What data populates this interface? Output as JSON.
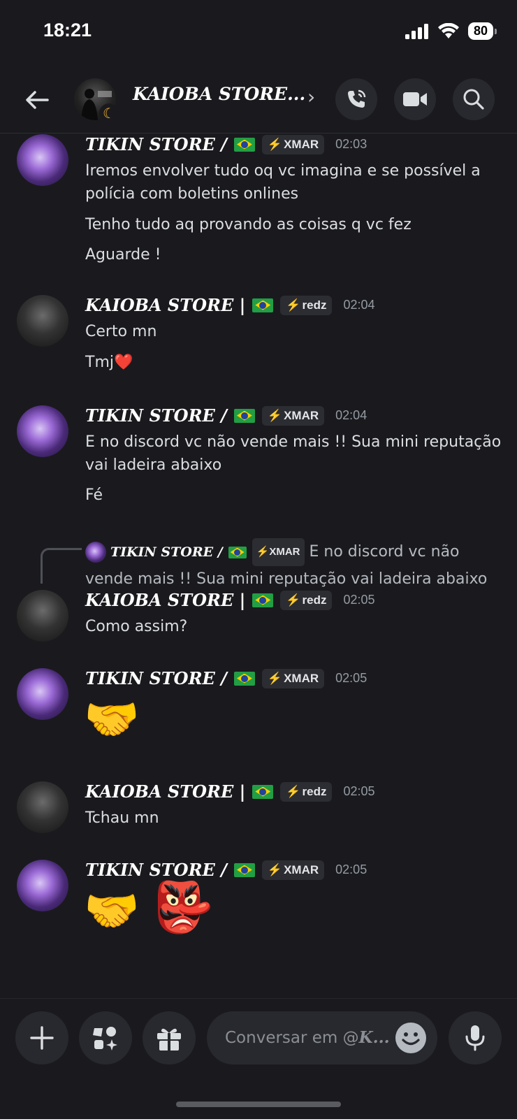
{
  "status_bar": {
    "time": "18:21",
    "battery": "80"
  },
  "header": {
    "title": "KAIOBA STORE..."
  },
  "messages": [
    {
      "author": "TIKIN STORE /",
      "tag": "XMAR",
      "time": "02:03",
      "lines": [
        "Iremos envolver tudo oq vc imagina e se possível a",
        "polícia com boletins onlines",
        "Tenho tudo aq provando as coisas q vc fez",
        "Aguarde !"
      ]
    },
    {
      "author": "KAIOBA STORE |",
      "tag": "redz",
      "time": "02:04",
      "lines": [
        "Certo mn",
        "Tmj❤️"
      ]
    },
    {
      "author": "TIKIN STORE /",
      "tag": "XMAR",
      "time": "02:04",
      "lines": [
        "E no discord vc não vende mais !! Sua mini reputação",
        "vai ladeira abaixo",
        "Fé"
      ]
    },
    {
      "author": "KAIOBA STORE |",
      "tag": "redz",
      "time": "02:05",
      "reply": {
        "author": "TIKIN STORE /",
        "tag": "XMAR",
        "text_1": "E no discord vc não",
        "text_2": "vende mais !! Sua mini reputação vai ladeira abaixo"
      },
      "lines": [
        "Como assim?"
      ]
    },
    {
      "author": "TIKIN STORE /",
      "tag": "XMAR",
      "time": "02:05",
      "emoji": "🤝"
    },
    {
      "author": "KAIOBA STORE |",
      "tag": "redz",
      "time": "02:05",
      "lines": [
        "Tchau mn"
      ]
    },
    {
      "author": "TIKIN STORE /",
      "tag": "XMAR",
      "time": "02:05",
      "emoji_1": "🤝",
      "emoji_2": "👺"
    }
  ],
  "composer": {
    "placeholder_prefix": "Conversar em @",
    "placeholder_name": "K..."
  },
  "colors": {
    "background": "#1a1a1e",
    "tag_bg": "#2c2d32",
    "xmar_bolt": "#f0b232",
    "redz_bolt": "#f23f43"
  }
}
